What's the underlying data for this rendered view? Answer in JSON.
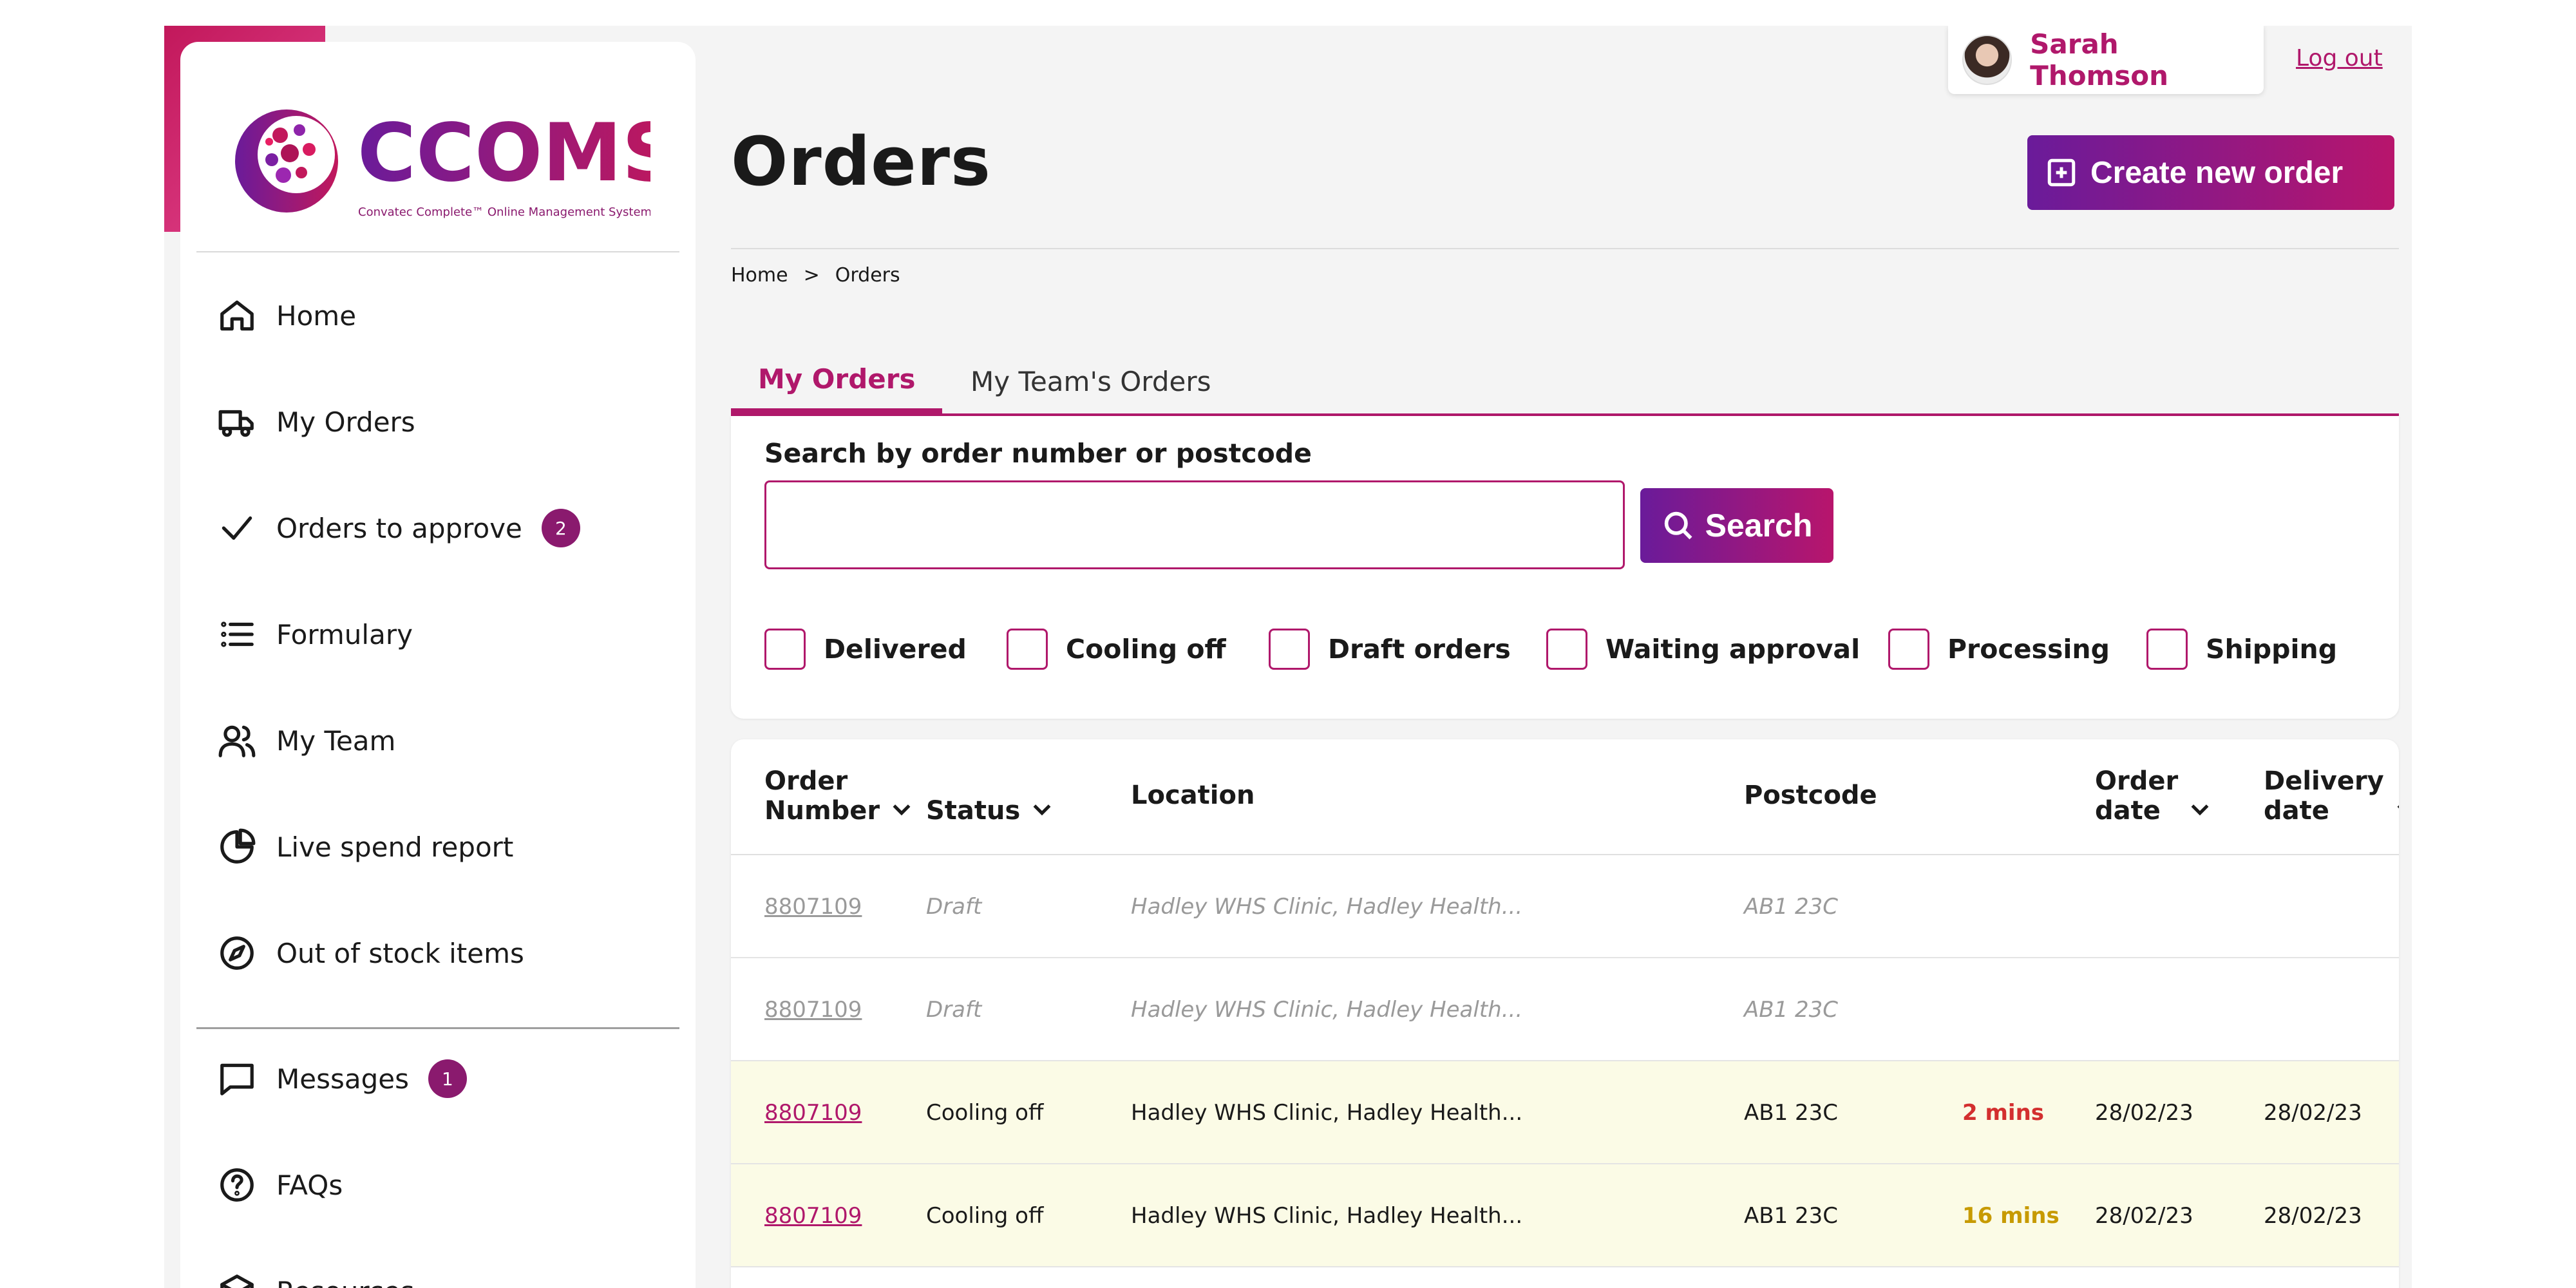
{
  "brand": {
    "name": "CCOMS",
    "tagline": "Convatec Complete™ Online Management System"
  },
  "user": {
    "name": "Sarah Thomson",
    "logout_label": "Log out"
  },
  "sidebar": {
    "items": [
      {
        "label": "Home",
        "icon": "home-icon"
      },
      {
        "label": "My Orders",
        "icon": "truck-icon"
      },
      {
        "label": "Orders to approve",
        "icon": "check-icon",
        "badge": "2"
      },
      {
        "label": "Formulary",
        "icon": "list-icon"
      },
      {
        "label": "My Team",
        "icon": "team-icon"
      },
      {
        "label": "Live spend report",
        "icon": "pie-chart-icon"
      },
      {
        "label": "Out of stock items",
        "icon": "compass-icon"
      },
      {
        "label": "Messages",
        "icon": "message-icon",
        "badge": "1"
      },
      {
        "label": "FAQs",
        "icon": "help-icon"
      },
      {
        "label": "Resources",
        "icon": "box-icon"
      }
    ]
  },
  "page": {
    "title": "Orders",
    "create_button": "Create new order",
    "breadcrumb": {
      "home": "Home",
      "separator": ">",
      "current": "Orders"
    }
  },
  "tabs": [
    {
      "label": "My Orders",
      "active": true
    },
    {
      "label": "My Team's Orders",
      "active": false
    }
  ],
  "search": {
    "label": "Search by order number or postcode",
    "value": "",
    "placeholder": "",
    "button": "Search"
  },
  "filters": [
    "Delivered",
    "Cooling off",
    "Draft orders",
    "Waiting approval",
    "Processing",
    "Shipping"
  ],
  "table": {
    "columns": {
      "order_number": [
        "Order",
        "Number"
      ],
      "status": "Status",
      "location": "Location",
      "postcode": "Postcode",
      "order_date": [
        "Order",
        "date"
      ],
      "delivery_date": [
        "Delivery",
        "date"
      ]
    },
    "rows": [
      {
        "order": "8807109",
        "status": "Draft",
        "location": "Hadley WHS Clinic, Hadley Health...",
        "postcode": "AB1 23C",
        "time": "",
        "order_date": "",
        "delivery_date": ""
      },
      {
        "order": "8807109",
        "status": "Draft",
        "location": "Hadley WHS Clinic, Hadley Health...",
        "postcode": "AB1 23C",
        "time": "",
        "order_date": "",
        "delivery_date": ""
      },
      {
        "order": "8807109",
        "status": "Cooling off",
        "location": "Hadley WHS Clinic, Hadley Health...",
        "postcode": "AB1 23C",
        "time": "2 mins",
        "order_date": "28/02/23",
        "delivery_date": "28/02/23"
      },
      {
        "order": "8807109",
        "status": "Cooling off",
        "location": "Hadley WHS Clinic, Hadley Health...",
        "postcode": "AB1 23C",
        "time": "16 mins",
        "order_date": "28/02/23",
        "delivery_date": "28/02/23"
      }
    ]
  },
  "colors": {
    "brand": "#b0186b",
    "gradient_start": "#6a1b9a",
    "gradient_end": "#b8156c",
    "highlight_row": "#fbfbe6",
    "time_red": "#d32f2f",
    "time_amber": "#c79a00"
  }
}
